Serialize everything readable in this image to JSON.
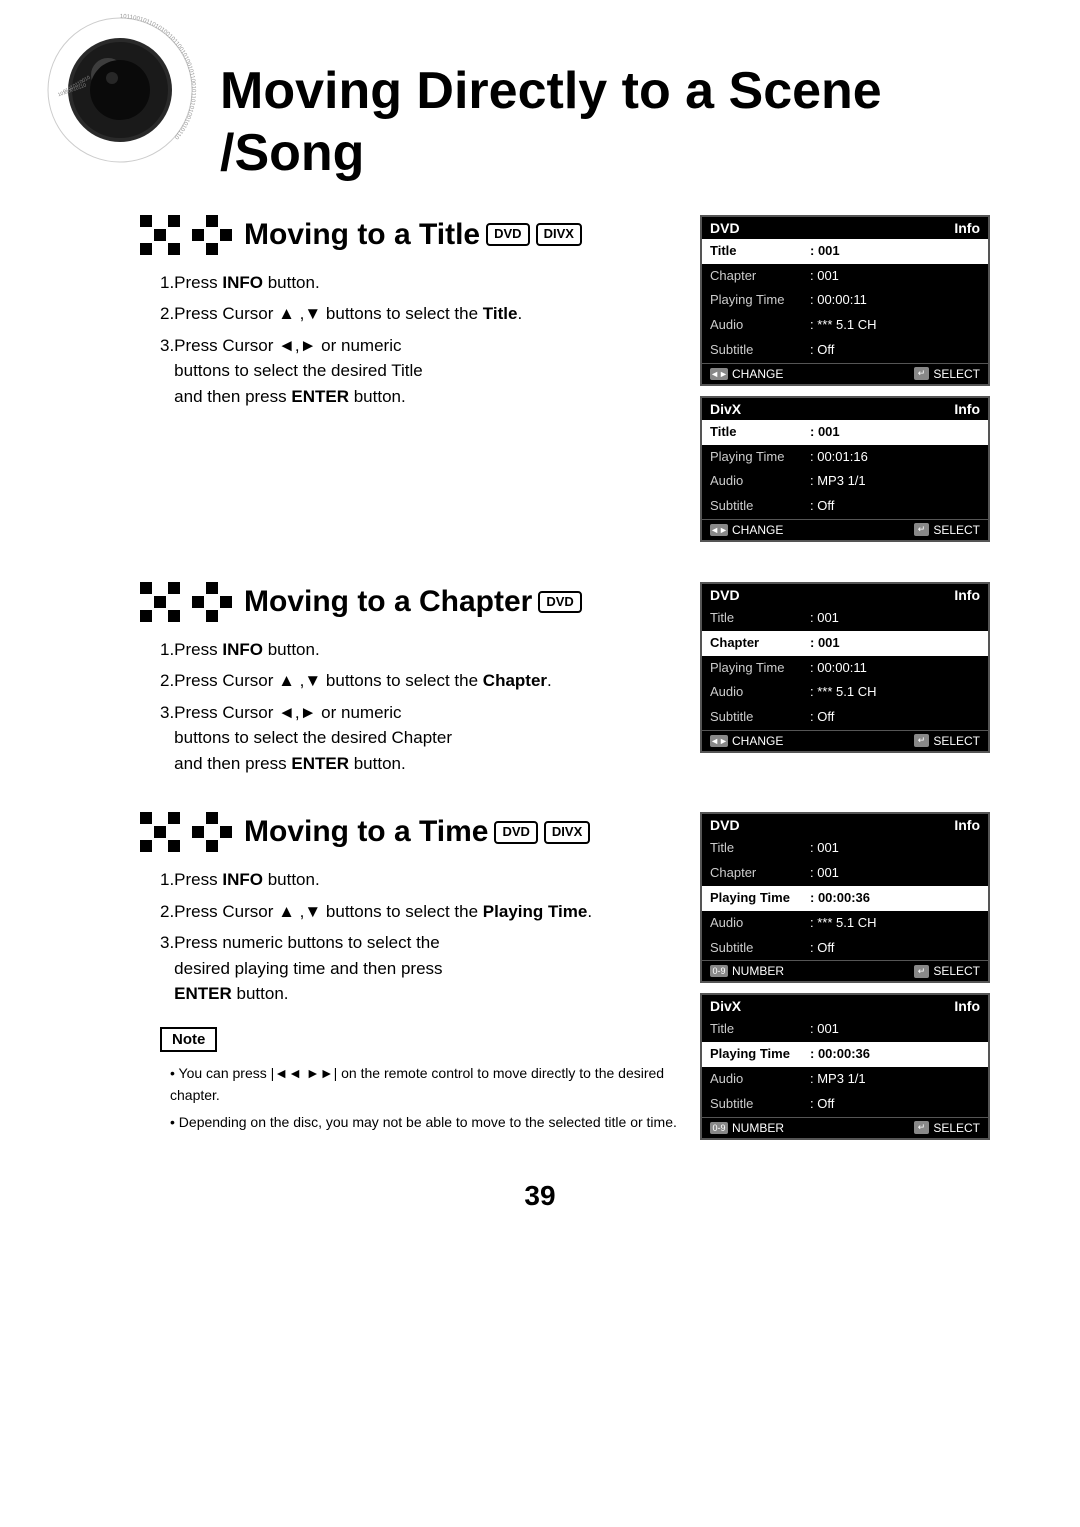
{
  "page": {
    "title": "Moving Directly to a Scene /Song",
    "number": "39"
  },
  "sections": [
    {
      "id": "title-section",
      "heading": "Moving to a Title",
      "badges": [
        "DVD",
        "DIVX"
      ],
      "steps": [
        {
          "number": "1",
          "text": "Press ",
          "bold": "INFO",
          "rest": " button."
        },
        {
          "number": "2",
          "text": "Press Cursor ▲ ,▼ buttons to select the ",
          "bold": "Title",
          "rest": "."
        },
        {
          "number": "3",
          "text": "Press Cursor ◄,► or numeric buttons to select the desired Title and then press ",
          "bold": "ENTER",
          "rest": " button."
        }
      ],
      "panels": [
        {
          "type": "DVD",
          "header_left": "DVD",
          "header_right": "Info",
          "rows": [
            {
              "label": "Title",
              "value": ": 001",
              "highlighted": true
            },
            {
              "label": "Chapter",
              "value": ": 001",
              "highlighted": false
            },
            {
              "label": "Playing Time",
              "value": ": 00:00:11",
              "highlighted": false
            },
            {
              "label": "Audio",
              "value": ": *** 5.1 CH",
              "highlighted": false
            },
            {
              "label": "Subtitle",
              "value": ": Off",
              "highlighted": false
            }
          ],
          "footer_left": "◄► CHANGE",
          "footer_right": "↵ SELECT"
        },
        {
          "type": "DivX",
          "header_left": "DivX",
          "header_right": "Info",
          "rows": [
            {
              "label": "Title",
              "value": ": 001",
              "highlighted": true
            },
            {
              "label": "Playing Time",
              "value": ": 00:01:16",
              "highlighted": false
            },
            {
              "label": "Audio",
              "value": ": MP3 1/1",
              "highlighted": false
            },
            {
              "label": "Subtitle",
              "value": ": Off",
              "highlighted": false
            }
          ],
          "footer_left": "◄► CHANGE",
          "footer_right": "↵ SELECT"
        }
      ]
    },
    {
      "id": "chapter-section",
      "heading": "Moving to a Chapter",
      "badges": [
        "DVD"
      ],
      "steps": [
        {
          "number": "1",
          "text": "Press ",
          "bold": "INFO",
          "rest": " button."
        },
        {
          "number": "2",
          "text": "Press Cursor ▲ ,▼ buttons to select the ",
          "bold": "Chapter",
          "rest": "."
        },
        {
          "number": "3",
          "text": "Press Cursor ◄,► or numeric buttons to select the desired Chapter and then press ",
          "bold": "ENTER",
          "rest": " button."
        }
      ],
      "panels": [
        {
          "type": "DVD",
          "header_left": "DVD",
          "header_right": "Info",
          "rows": [
            {
              "label": "Title",
              "value": ": 001",
              "highlighted": false
            },
            {
              "label": "Chapter",
              "value": ": 001",
              "highlighted": true
            },
            {
              "label": "Playing Time",
              "value": ": 00:00:11",
              "highlighted": false
            },
            {
              "label": "Audio",
              "value": ": *** 5.1 CH",
              "highlighted": false
            },
            {
              "label": "Subtitle",
              "value": ": Off",
              "highlighted": false
            }
          ],
          "footer_left": "◄► CHANGE",
          "footer_right": "↵ SELECT"
        }
      ]
    },
    {
      "id": "time-section",
      "heading": "Moving to a Time",
      "badges": [
        "DVD",
        "DIVX"
      ],
      "steps": [
        {
          "number": "1",
          "text": "Press ",
          "bold": "INFO",
          "rest": " button."
        },
        {
          "number": "2",
          "text": "Press Cursor ▲ ,▼ buttons to select the ",
          "bold": "Playing Time",
          "rest": "."
        },
        {
          "number": "3",
          "text": "Press numeric buttons to select the desired playing time and then press ",
          "bold": "ENTER",
          "rest": " button."
        }
      ],
      "panels": [
        {
          "type": "DVD",
          "header_left": "DVD",
          "header_right": "Info",
          "rows": [
            {
              "label": "Title",
              "value": ": 001",
              "highlighted": false
            },
            {
              "label": "Chapter",
              "value": ": 001",
              "highlighted": false
            },
            {
              "label": "Playing Time",
              "value": ": 00:00:36",
              "highlighted": true
            },
            {
              "label": "Audio",
              "value": ": *** 5.1 CH",
              "highlighted": false
            },
            {
              "label": "Subtitle",
              "value": ": Off",
              "highlighted": false
            }
          ],
          "footer_left": "0~9 NUMBER",
          "footer_right": "↵ SELECT"
        },
        {
          "type": "DivX",
          "header_left": "DivX",
          "header_right": "Info",
          "rows": [
            {
              "label": "Title",
              "value": ": 001",
              "highlighted": false
            },
            {
              "label": "Playing Time",
              "value": ": 00:00:36",
              "highlighted": true
            },
            {
              "label": "Audio",
              "value": ": MP3 1/1",
              "highlighted": false
            },
            {
              "label": "Subtitle",
              "value": ": Off",
              "highlighted": false
            }
          ],
          "footer_left": "0~9 NUMBER",
          "footer_right": "↵ SELECT"
        }
      ]
    }
  ],
  "note": {
    "label": "Note",
    "bullets": [
      "You can press |◄◄ ►►| on the remote control to move directly to the desired chapter.",
      "Depending on the disc, you may not be able to move to the selected title or time."
    ]
  }
}
